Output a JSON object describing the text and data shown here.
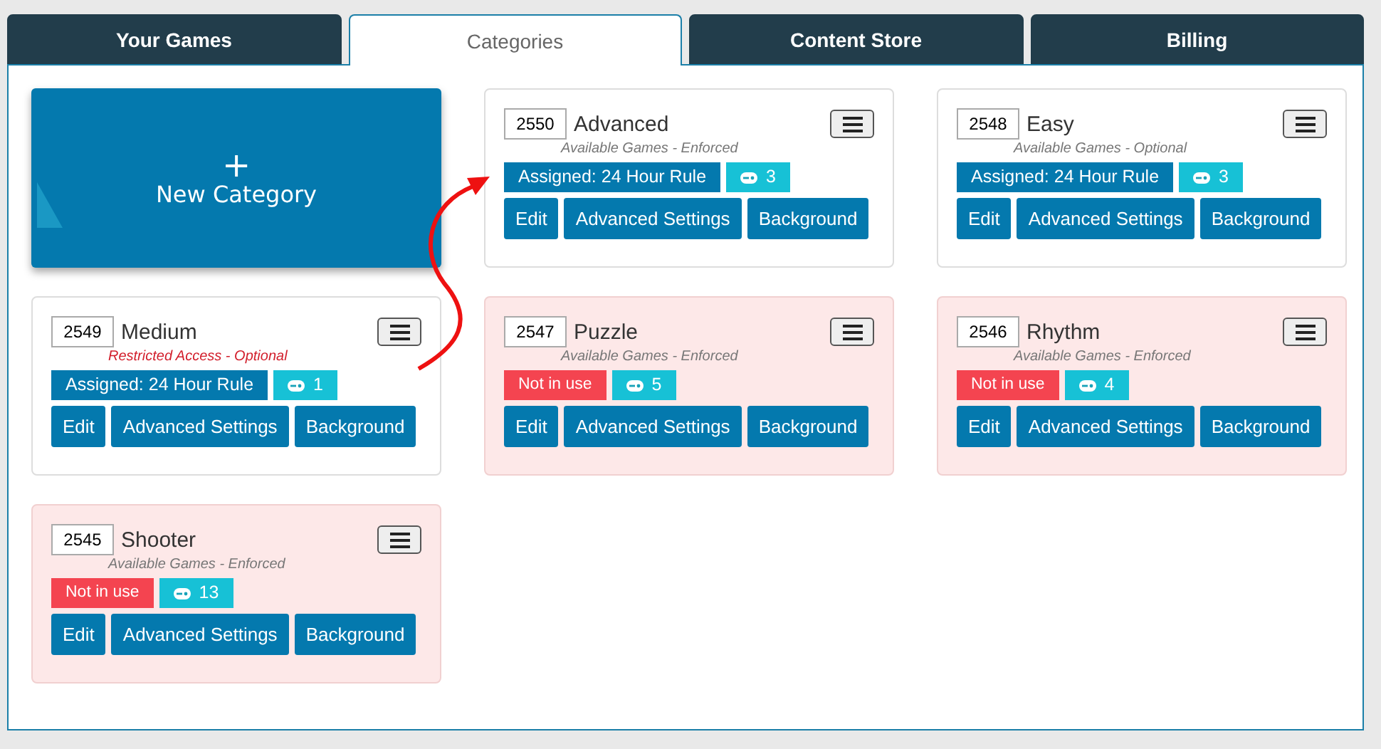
{
  "tabs": [
    {
      "label": "Your Games",
      "selected": false
    },
    {
      "label": "Categories",
      "selected": true
    },
    {
      "label": "Content Store",
      "selected": false
    },
    {
      "label": "Billing",
      "selected": false
    }
  ],
  "new_category": {
    "icon": "+",
    "label": "New Category"
  },
  "categories": [
    {
      "id": "2550",
      "name": "Advanced",
      "note": "Available Games - Enforced",
      "restricted": false,
      "in_use": true,
      "status": "Assigned: 24 Hour Rule",
      "count": "3",
      "buttons": [
        "Edit",
        "Advanced Settings",
        "Background"
      ]
    },
    {
      "id": "2548",
      "name": "Easy",
      "note": "Available Games - Optional",
      "restricted": false,
      "in_use": true,
      "status": "Assigned: 24 Hour Rule",
      "count": "3",
      "buttons": [
        "Edit",
        "Advanced Settings",
        "Background"
      ]
    },
    {
      "id": "2549",
      "name": "Medium",
      "note": "Restricted Access - Optional",
      "restricted": true,
      "in_use": true,
      "status": "Assigned: 24 Hour Rule",
      "count": "1",
      "buttons": [
        "Edit",
        "Advanced Settings",
        "Background"
      ]
    },
    {
      "id": "2547",
      "name": "Puzzle",
      "note": "Available Games - Enforced",
      "restricted": false,
      "in_use": false,
      "status": "Not in use",
      "count": "5",
      "buttons": [
        "Edit",
        "Advanced Settings",
        "Background"
      ]
    },
    {
      "id": "2546",
      "name": "Rhythm",
      "note": "Available Games - Enforced",
      "restricted": false,
      "in_use": false,
      "status": "Not in use",
      "count": "4",
      "buttons": [
        "Edit",
        "Advanced Settings",
        "Background"
      ]
    },
    {
      "id": "2545",
      "name": "Shooter",
      "note": "Available Games - Enforced",
      "restricted": false,
      "in_use": false,
      "status": "Not in use",
      "count": "13",
      "buttons": [
        "Edit",
        "Advanced Settings",
        "Background"
      ]
    }
  ]
}
